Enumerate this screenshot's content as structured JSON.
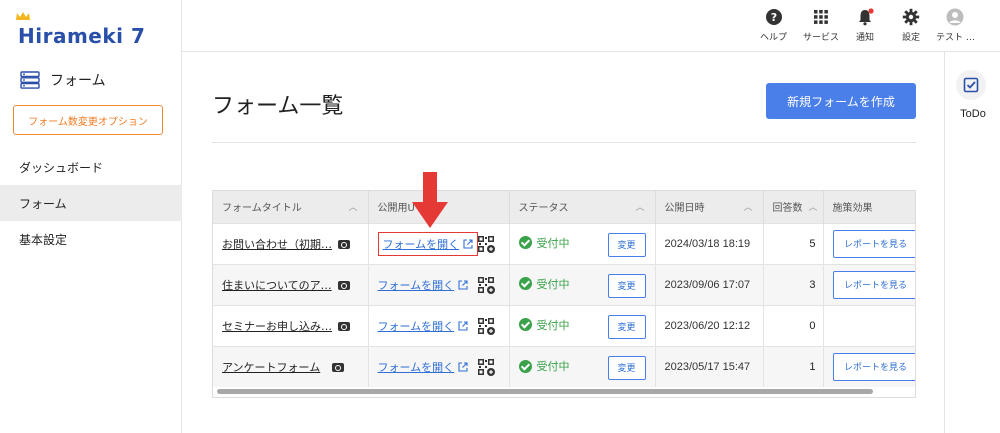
{
  "brand": {
    "logo_text": "Hirameki 7"
  },
  "sidebar": {
    "section_title": "フォーム",
    "option_button": "フォーム数変更オプション",
    "items": [
      {
        "label": "ダッシュボード",
        "active": false
      },
      {
        "label": "フォーム",
        "active": true
      },
      {
        "label": "基本設定",
        "active": false
      }
    ]
  },
  "header": {
    "items": [
      {
        "label": "ヘルプ",
        "icon": "help-icon"
      },
      {
        "label": "サービス",
        "icon": "grid-icon"
      },
      {
        "label": "通知",
        "icon": "bell-icon"
      },
      {
        "label": "設定",
        "icon": "gear-icon"
      },
      {
        "label": "テスト …",
        "icon": "user-icon"
      }
    ],
    "accent": "#e53935"
  },
  "main": {
    "title": "フォーム一覧",
    "create_button": "新規フォームを作成"
  },
  "right_panel": {
    "todo_label": "ToDo"
  },
  "table": {
    "columns": [
      "フォームタイトル",
      "公開用U",
      "ステータス",
      "公開日時",
      "回答数",
      "施策効果"
    ],
    "rows": [
      {
        "title": "お問い合わせ（初期…",
        "link": "フォームを開く",
        "status": "受付中",
        "change": "変更",
        "date": "2024/03/18 18:19",
        "count": "5",
        "report": "レポートを見る"
      },
      {
        "title": "住まいについてのア…",
        "link": "フォームを開く",
        "status": "受付中",
        "change": "変更",
        "date": "2023/09/06 17:07",
        "count": "3",
        "report": "レポートを見る"
      },
      {
        "title": "セミナーお申し込み…",
        "link": "フォームを開く",
        "status": "受付中",
        "change": "変更",
        "date": "2023/06/20 12:12",
        "count": "0",
        "report": ""
      },
      {
        "title": "アンケートフォーム",
        "link": "フォームを開く",
        "status": "受付中",
        "change": "変更",
        "date": "2023/05/17 15:47",
        "count": "1",
        "report": "レポートを見る"
      }
    ]
  },
  "colors": {
    "primary": "#4a7ee8",
    "success": "#3aa24a",
    "warning": "#f07a20",
    "annotation": "#e53935"
  }
}
